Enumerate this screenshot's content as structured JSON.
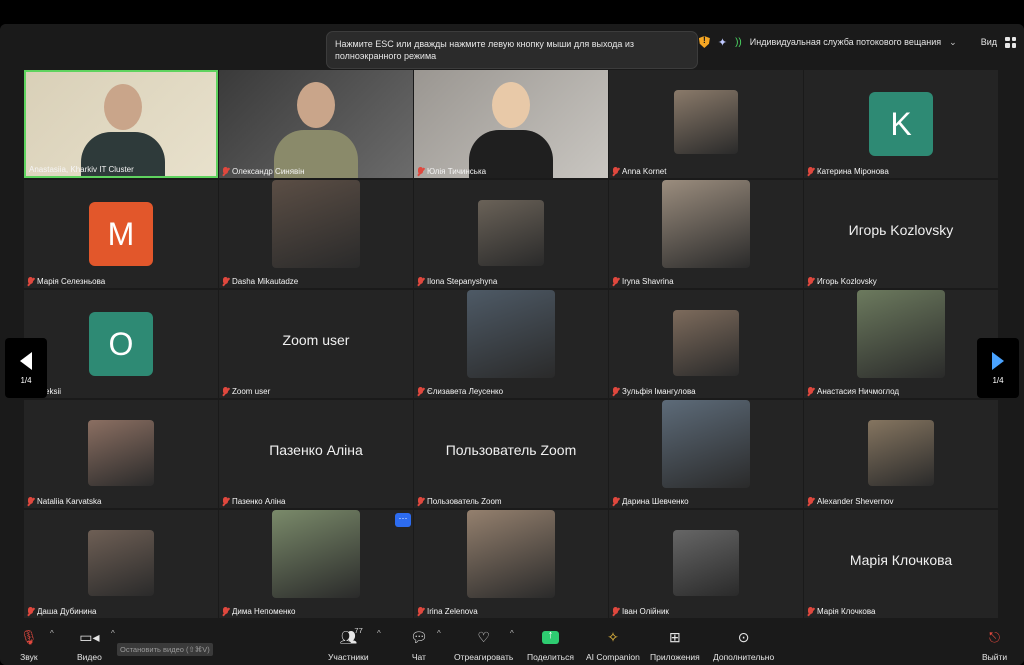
{
  "window": {
    "esc_tip": "Нажмите ESC или дважды нажмите левую кнопку мыши для выхода из полноэкранного режима",
    "streaming": "Индивидуальная служба потокового вещания",
    "view": "Вид"
  },
  "tiles": [
    {
      "name": "Anastasiia, Kharkiv IT Cluster",
      "kind": "video",
      "muted": false,
      "active": true
    },
    {
      "name": "Олександр Синявін",
      "kind": "video",
      "muted": true
    },
    {
      "name": "Юлія Тичинська",
      "kind": "video",
      "muted": true
    },
    {
      "name": "Anna Kornet",
      "kind": "photo",
      "muted": true
    },
    {
      "name": "Катерина Міронова",
      "kind": "avatar",
      "letter": "K",
      "color": "#2e8a74",
      "muted": true
    },
    {
      "name": "Марія Селезньова",
      "kind": "avatar",
      "letter": "M",
      "color": "#e2572b",
      "muted": true
    },
    {
      "name": "Dasha Mikautadze",
      "kind": "photo",
      "muted": true
    },
    {
      "name": "Ilona Stepanyshyna",
      "kind": "photo",
      "muted": true
    },
    {
      "name": "Iryna Shavrina",
      "kind": "photo",
      "muted": true
    },
    {
      "name": "Игорь Kozlovsky",
      "kind": "text",
      "muted": true
    },
    {
      "name": "Oleksii",
      "kind": "avatar",
      "letter": "O",
      "color": "#2e8a74",
      "muted": true
    },
    {
      "name": "Zoom user",
      "kind": "text",
      "muted": true
    },
    {
      "name": "Єлизавета Леусенко",
      "kind": "photo",
      "muted": true
    },
    {
      "name": "Зульфія Імангулова",
      "kind": "photo",
      "muted": true
    },
    {
      "name": "Анастасия Ничмоглод",
      "kind": "photo",
      "muted": true
    },
    {
      "name": "Nataliia Karvatska",
      "kind": "photo",
      "muted": true
    },
    {
      "name": "Пазенко Аліна",
      "kind": "text",
      "muted": true
    },
    {
      "name": "Пользователь Zoom",
      "kind": "text",
      "muted": true
    },
    {
      "name": "Дарина Шевченко",
      "kind": "photo",
      "muted": true
    },
    {
      "name": "Alexander Shevernov",
      "kind": "photo",
      "muted": true
    },
    {
      "name": "Даша Дубинина",
      "kind": "photo",
      "muted": true
    },
    {
      "name": "Дима Непоменко",
      "kind": "photo",
      "muted": true
    },
    {
      "name": "Irina Zelenova",
      "kind": "photo",
      "muted": true
    },
    {
      "name": "Іван Олійник",
      "kind": "photo",
      "muted": true
    },
    {
      "name": "Марія Клочкова",
      "kind": "text",
      "muted": true
    }
  ],
  "pager": {
    "left": "1/4",
    "right": "1/4"
  },
  "more": "···",
  "toolbar": {
    "audio": "Звук",
    "video": "Видео",
    "stop_video_tip": "Остановить видео (⇧⌘V)",
    "participants": "Участники",
    "participants_count": "77",
    "chat": "Чат",
    "react": "Отреагировать",
    "share": "Поделиться",
    "companion": "AI Companion",
    "apps": "Приложения",
    "more": "Дополнительно",
    "exit": "Выйти"
  },
  "colors": {
    "accent": "#2d6cf0",
    "active_border": "#5fd35f",
    "muted": "#e0483e",
    "share": "#2ecc71"
  }
}
